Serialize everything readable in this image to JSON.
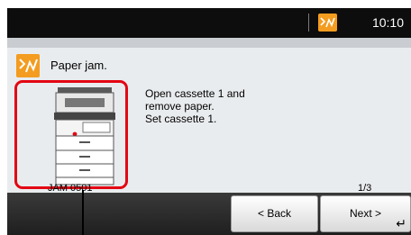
{
  "status_bar": {
    "time": "10:10",
    "status_icon": "paper-jam-icon"
  },
  "message": {
    "icon": "paper-jam-icon",
    "title": "Paper jam.",
    "instructions": [
      "Open cassette 1 and",
      "remove paper.",
      "Set cassette 1."
    ],
    "jam_code": "JAM 0501",
    "page_indicator": "1/3"
  },
  "buttons": {
    "back": "< Back",
    "next": "Next >"
  },
  "colors": {
    "accent_orange": "#f39c1f",
    "highlight_red": "#e30613"
  }
}
